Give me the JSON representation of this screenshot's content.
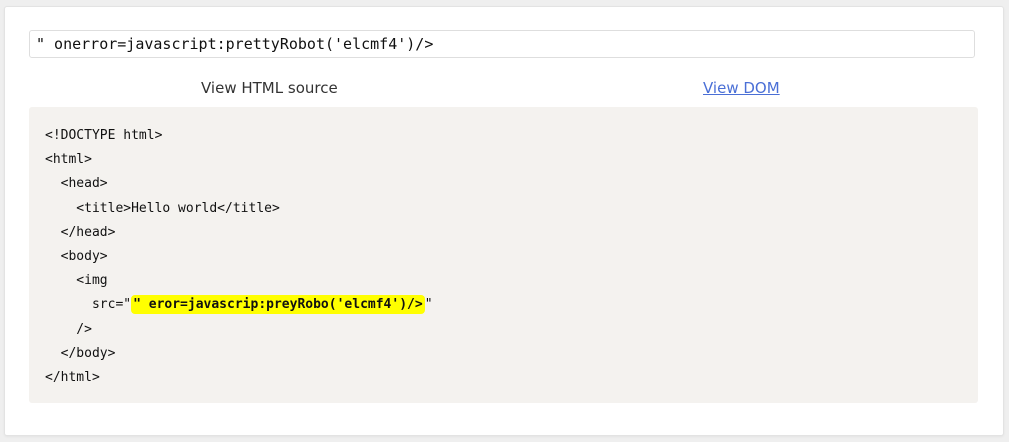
{
  "payload_input": {
    "value": "\" onerror=javascript:prettyRobot('elcmf4')/>"
  },
  "tabs": {
    "source_label": "View HTML source",
    "dom_label": "View DOM"
  },
  "code": {
    "lines": {
      "l0": "<!DOCTYPE html>",
      "l1": "<html>",
      "l2": "  <head>",
      "l3": "    <title>Hello world</title>",
      "l4": "  </head>",
      "l5": "  <body>",
      "l6": "    <img",
      "l7_prefix": "      src=\"",
      "l7_highlight": "\" eror=javascrip:preyRobo('elcmf4')/>",
      "l7_suffix": "\"",
      "l8": "    />",
      "l9": "  </body>",
      "l10": "</html>"
    },
    "highlight_color": "#ffff00",
    "background_color": "#f4f2ef"
  }
}
